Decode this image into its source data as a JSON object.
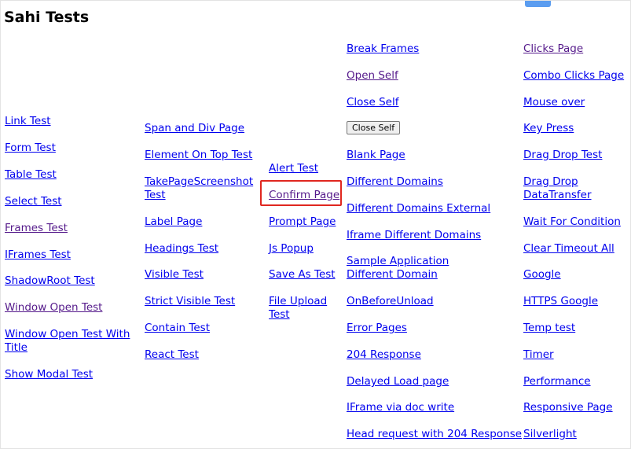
{
  "page_title": "Sahi Tests",
  "col1": [
    {
      "label": "Link Test"
    },
    {
      "label": "Form Test"
    },
    {
      "label": "Table Test"
    },
    {
      "label": "Select Test"
    },
    {
      "label": "Frames Test",
      "visited": true
    },
    {
      "label": "IFrames Test"
    },
    {
      "label": "ShadowRoot Test"
    },
    {
      "label": "Window Open Test",
      "visited": true
    },
    {
      "label": "Window Open Test With Title"
    },
    {
      "label": "Show Modal Test"
    }
  ],
  "col2": [
    {
      "label": "Span and Div Page"
    },
    {
      "label": "Element On Top Test"
    },
    {
      "label": "TakePageScreenshot Test"
    },
    {
      "label": "Label Page"
    },
    {
      "label": "Headings Test"
    },
    {
      "label": "Visible Test"
    },
    {
      "label": "Strict Visible Test"
    },
    {
      "label": "Contain Test"
    },
    {
      "label": "React Test"
    }
  ],
  "col3": [
    {
      "label": "Alert Test"
    },
    {
      "label": "Confirm Page",
      "visited": true
    },
    {
      "label": "Prompt Page"
    },
    {
      "label": "Js Popup"
    },
    {
      "label": "Save As Test"
    },
    {
      "label": "File Upload Test"
    }
  ],
  "col4": [
    {
      "label": "Break Frames"
    },
    {
      "label": "Open Self",
      "visited": true
    },
    {
      "label": "Close Self"
    },
    {
      "button": "Close Self"
    },
    {
      "label": "Blank Page"
    },
    {
      "label": "Different Domains"
    },
    {
      "label": "Different Domains External"
    },
    {
      "label": "Iframe Different Domains"
    },
    {
      "label": "Sample Application Different Domain"
    },
    {
      "label": "OnBeforeUnload"
    },
    {
      "label": "Error Pages"
    },
    {
      "label": "204 Response"
    },
    {
      "label": "Delayed Load page"
    },
    {
      "label": "IFrame via doc write"
    },
    {
      "label": "Head request with 204 Response"
    }
  ],
  "col5": [
    {
      "label": "Clicks Page",
      "visited": true
    },
    {
      "label": "Combo Clicks Page"
    },
    {
      "label": "Mouse over"
    },
    {
      "label": "Key Press"
    },
    {
      "label": "Drag Drop Test"
    },
    {
      "label": "Drag Drop DataTransfer"
    },
    {
      "label": "Wait For Condition"
    },
    {
      "label": "Clear Timeout All"
    },
    {
      "label": "Google"
    },
    {
      "label": "HTTPS Google"
    },
    {
      "label": "Temp test"
    },
    {
      "label": "Timer"
    },
    {
      "label": "Performance"
    },
    {
      "label": "Responsive Page"
    },
    {
      "label": "Silverlight"
    }
  ],
  "colors": {
    "link": "#0000ee",
    "visited": "#551a8b",
    "highlight": "#e0271f"
  }
}
